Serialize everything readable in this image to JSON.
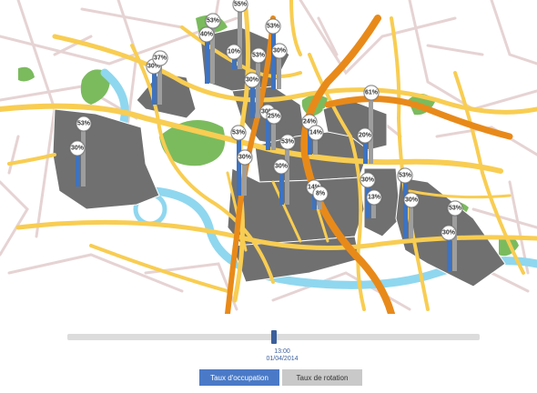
{
  "colors": {
    "road_major": "#f8cd52",
    "road_minor": "#e6d3d3",
    "highway": "#e88a1a",
    "park": "#7bbb5e",
    "river": "#8fd7ef",
    "district": "#707070",
    "bar_occupancy": "#3e73c0",
    "bar_rotation": "#9e9e9e",
    "timeline_handle": "#3b5f9b",
    "tab_active": "#4a7ac7",
    "tab_inactive": "#c9c9c9"
  },
  "zones": [
    {
      "occupancy_label": "30%",
      "occupancy": 30,
      "rotation_label": "53%",
      "rotation": 53
    },
    {
      "occupancy_label": "30%",
      "occupancy": 30,
      "rotation_label": "37%",
      "rotation": 37
    },
    {
      "occupancy_label": "40%",
      "occupancy": 40,
      "rotation_label": "53%",
      "rotation": 53
    },
    {
      "occupancy_label": "10%",
      "occupancy": 10,
      "rotation_label": "55%",
      "rotation": 55
    },
    {
      "occupancy_label": "30%",
      "occupancy": 30,
      "rotation_label": "53%",
      "rotation": 53
    },
    {
      "occupancy_label": "53%",
      "occupancy": 53,
      "rotation_label": "30%",
      "rotation": 30
    },
    {
      "occupancy_label": "30%",
      "occupancy": 30,
      "rotation_label": "25%",
      "rotation": 25
    },
    {
      "occupancy_label": "53%",
      "occupancy": 53,
      "rotation_label": "30%",
      "rotation": 30
    },
    {
      "occupancy_label": "24%",
      "occupancy": 24,
      "rotation_label": "14%",
      "rotation": 14
    },
    {
      "occupancy_label": "20%",
      "occupancy": 20,
      "rotation_label": "61%",
      "rotation": 61
    },
    {
      "occupancy_label": "30%",
      "occupancy": 30,
      "rotation_label": "53%",
      "rotation": 53
    },
    {
      "occupancy_label": "14%",
      "occupancy": 14,
      "rotation_label": "8%",
      "rotation": 8
    },
    {
      "occupancy_label": "30%",
      "occupancy": 30,
      "rotation_label": "13%",
      "rotation": 13
    },
    {
      "occupancy_label": "53%",
      "occupancy": 53,
      "rotation_label": "30%",
      "rotation": 30
    },
    {
      "occupancy_label": "30%",
      "occupancy": 30,
      "rotation_label": "53%",
      "rotation": 53
    }
  ],
  "timeline": {
    "time": "13:00",
    "date": "01/04/2014",
    "position": 0.5
  },
  "tabs": {
    "occupancy_label": "Taux d'occupation",
    "rotation_label": "Taux de rotation",
    "active": "occupancy"
  }
}
